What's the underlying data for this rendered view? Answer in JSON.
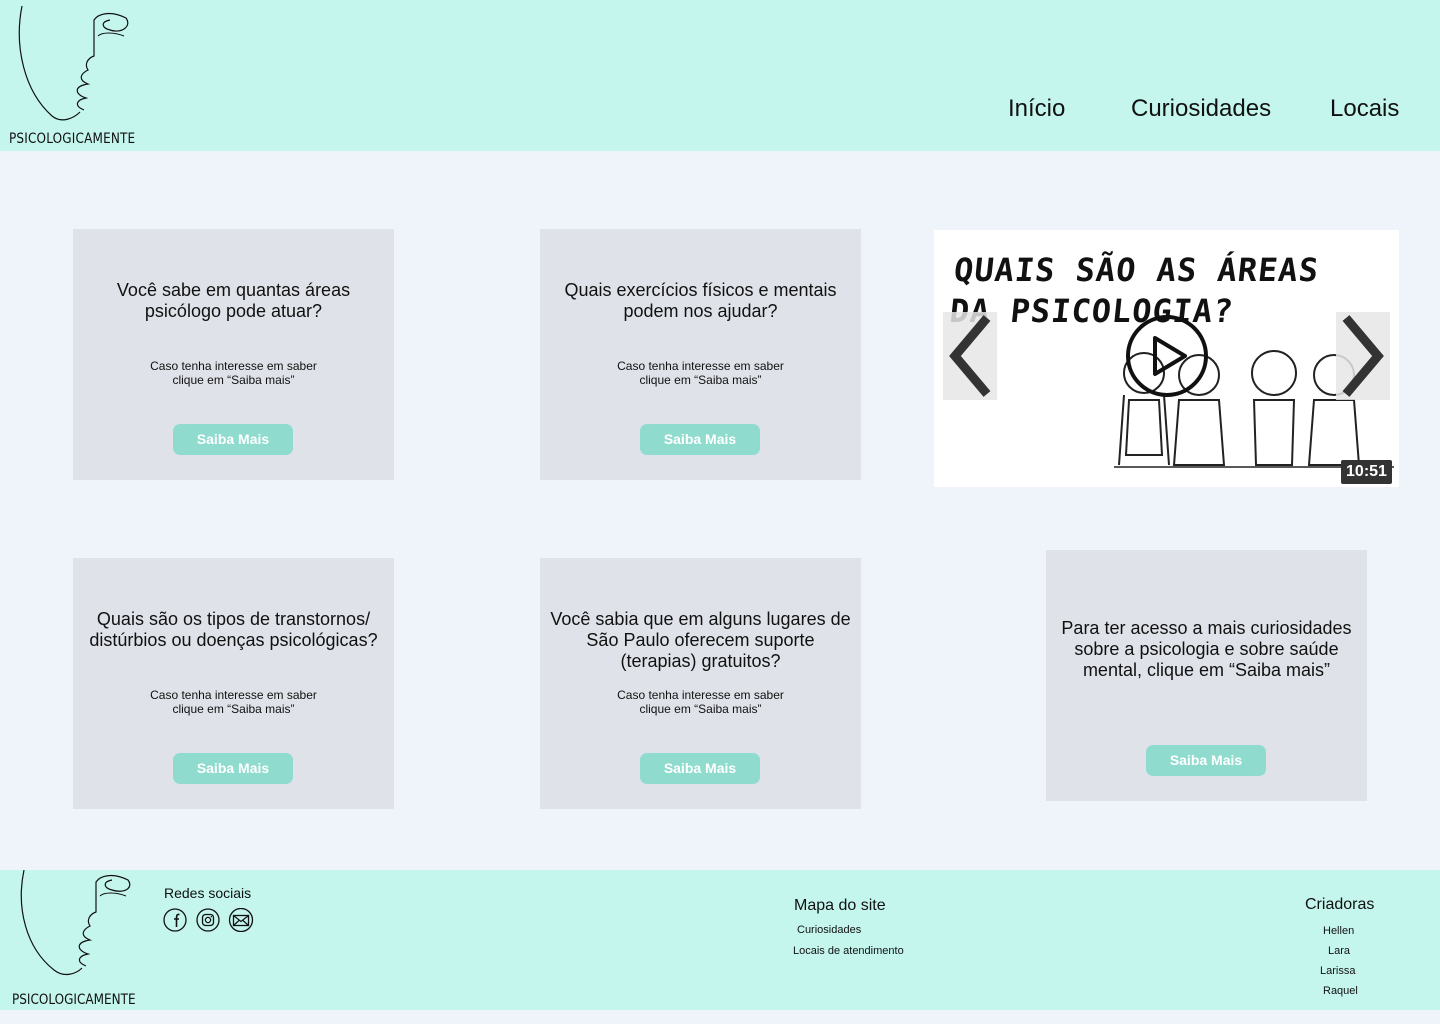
{
  "header": {
    "brand": "PSICOLOGICAMENTE",
    "nav": [
      "Início",
      "Curiosidades",
      "Locais"
    ]
  },
  "cards": [
    {
      "title": "Você sabe em quantas áreas psicólogo pode atuar?",
      "subtitle": "Caso tenha interesse em saber clique em “Saiba mais”",
      "button": "Saiba Mais"
    },
    {
      "title": "Quais exercícios físicos e mentais podem nos ajudar?",
      "subtitle": "Caso tenha interesse em saber clique em “Saiba mais”",
      "button": "Saiba Mais"
    },
    {
      "title": "Quais são os tipos de transtornos/ distúrbios ou doenças psicológicas?",
      "subtitle": "Caso tenha interesse em saber clique em “Saiba mais”",
      "button": "Saiba Mais"
    },
    {
      "title": "Você sabia que em alguns lugares de São Paulo oferecem suporte (terapias) gratuitos?",
      "subtitle": "Caso tenha interesse em saber clique em “Saiba mais”",
      "button": "Saiba Mais"
    },
    {
      "title": "Para ter acesso a mais curiosidades sobre a psicologia e sobre saúde mental, clique em “Saiba mais”",
      "button": "Saiba Mais"
    }
  ],
  "video": {
    "title_line1": "QUAIS SÃO AS ÁREAS",
    "title_line2": "DA PSICOLOGIA?",
    "duration": "10:51",
    "icons": {
      "prev": "chevron-left-icon",
      "next": "chevron-right-icon",
      "play": "play-icon"
    }
  },
  "footer": {
    "brand": "PSICOLOGICAMENTE",
    "social_heading": "Redes sociais",
    "social_icons": [
      "facebook-icon",
      "instagram-icon",
      "email-icon"
    ],
    "sitemap_heading": "Mapa do site",
    "sitemap_links": [
      "Curiosidades",
      "Locais de atendimento"
    ],
    "creators_heading": "Criadoras",
    "creators": [
      "Hellen",
      "Lara",
      "Larissa",
      "Raquel"
    ]
  },
  "colors": {
    "header_bg": "#c4f6ee",
    "page_bg": "#eff4fb",
    "card_bg": "#dfe3e9",
    "button_bg": "#8fdccf"
  }
}
